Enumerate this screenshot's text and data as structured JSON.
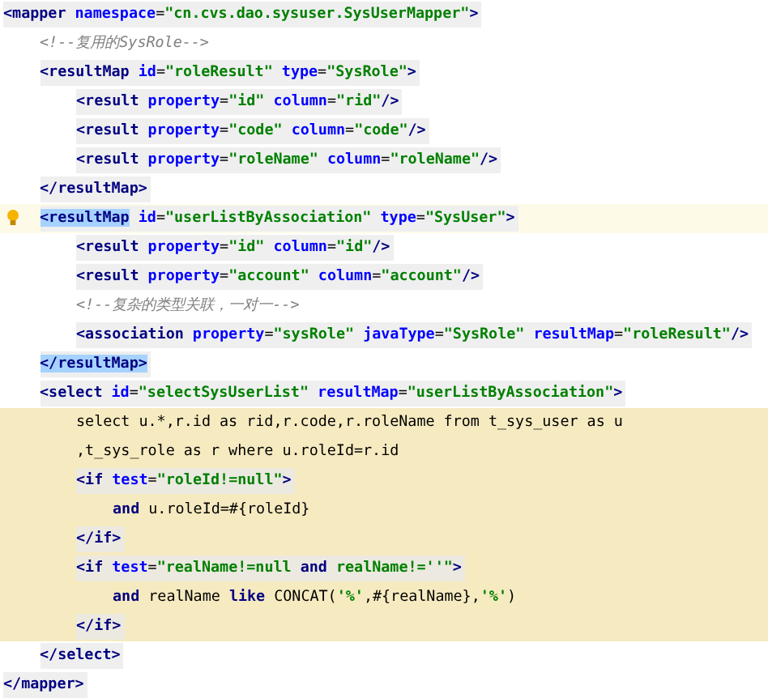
{
  "editor": {
    "lines": [
      {
        "kind": "tag",
        "tokens": [
          {
            "kind": "tag",
            "text": "<mapper"
          },
          {
            "kind": "attr",
            "text": " namespace"
          },
          {
            "kind": "punct",
            "text": "="
          },
          {
            "kind": "value",
            "text": "\"cn.cvs.dao.sysuser.SysUserMapper\""
          },
          {
            "kind": "tag",
            "text": ">"
          }
        ],
        "children": [
          {
            "kind": "comment",
            "tokens": [
              {
                "kind": "comment",
                "text": "<!--复用的SysRole-->"
              }
            ]
          },
          {
            "kind": "tag",
            "tokens": [
              {
                "kind": "tag",
                "text": "<resultMap"
              },
              {
                "kind": "attr",
                "text": " id"
              },
              {
                "kind": "punct",
                "text": "="
              },
              {
                "kind": "value",
                "text": "\"roleResult\""
              },
              {
                "kind": "attr",
                "text": " type"
              },
              {
                "kind": "punct",
                "text": "="
              },
              {
                "kind": "value",
                "text": "\"SysRole\""
              },
              {
                "kind": "tag",
                "text": ">"
              }
            ],
            "children": [
              {
                "kind": "tag",
                "tokens": [
                  {
                    "kind": "tag",
                    "text": "<result"
                  },
                  {
                    "kind": "attr",
                    "text": " property"
                  },
                  {
                    "kind": "punct",
                    "text": "="
                  },
                  {
                    "kind": "value",
                    "text": "\"id\""
                  },
                  {
                    "kind": "attr",
                    "text": " column"
                  },
                  {
                    "kind": "punct",
                    "text": "="
                  },
                  {
                    "kind": "value",
                    "text": "\"rid\""
                  },
                  {
                    "kind": "tag",
                    "text": "/>"
                  }
                ]
              },
              {
                "kind": "tag",
                "tokens": [
                  {
                    "kind": "tag",
                    "text": "<result"
                  },
                  {
                    "kind": "attr",
                    "text": " property"
                  },
                  {
                    "kind": "punct",
                    "text": "="
                  },
                  {
                    "kind": "value",
                    "text": "\"code\""
                  },
                  {
                    "kind": "attr",
                    "text": " column"
                  },
                  {
                    "kind": "punct",
                    "text": "="
                  },
                  {
                    "kind": "value",
                    "text": "\"code\""
                  },
                  {
                    "kind": "tag",
                    "text": "/>"
                  }
                ]
              },
              {
                "kind": "tag",
                "tokens": [
                  {
                    "kind": "tag",
                    "text": "<result"
                  },
                  {
                    "kind": "attr",
                    "text": " property"
                  },
                  {
                    "kind": "punct",
                    "text": "="
                  },
                  {
                    "kind": "value",
                    "text": "\"roleName\""
                  },
                  {
                    "kind": "attr",
                    "text": " column"
                  },
                  {
                    "kind": "punct",
                    "text": "="
                  },
                  {
                    "kind": "value",
                    "text": "\"roleName\""
                  },
                  {
                    "kind": "tag",
                    "text": "/>"
                  }
                ]
              }
            ]
          },
          {
            "kind": "tag",
            "tokens": [
              {
                "kind": "tag",
                "text": "</resultMap>"
              }
            ]
          },
          {
            "kind": "tag",
            "current_line": true,
            "bulb": true,
            "tokens": [
              {
                "kind": "tag",
                "text": "<resultMap",
                "selected": true
              },
              {
                "kind": "attr",
                "text": " id"
              },
              {
                "kind": "punct",
                "text": "="
              },
              {
                "kind": "value",
                "text": "\"userListByAssociation\""
              },
              {
                "kind": "attr",
                "text": " type"
              },
              {
                "kind": "punct",
                "text": "="
              },
              {
                "kind": "value",
                "text": "\"SysUser\""
              },
              {
                "kind": "tag",
                "text": ">"
              }
            ],
            "children": [
              {
                "kind": "tag",
                "tokens": [
                  {
                    "kind": "tag",
                    "text": "<result"
                  },
                  {
                    "kind": "attr",
                    "text": " property"
                  },
                  {
                    "kind": "punct",
                    "text": "="
                  },
                  {
                    "kind": "value",
                    "text": "\"id\""
                  },
                  {
                    "kind": "attr",
                    "text": " column"
                  },
                  {
                    "kind": "punct",
                    "text": "="
                  },
                  {
                    "kind": "value",
                    "text": "\"id\""
                  },
                  {
                    "kind": "tag",
                    "text": "/>"
                  }
                ]
              },
              {
                "kind": "tag",
                "tokens": [
                  {
                    "kind": "tag",
                    "text": "<result"
                  },
                  {
                    "kind": "attr",
                    "text": " property"
                  },
                  {
                    "kind": "punct",
                    "text": "="
                  },
                  {
                    "kind": "value",
                    "text": "\"account\""
                  },
                  {
                    "kind": "attr",
                    "text": " column"
                  },
                  {
                    "kind": "punct",
                    "text": "="
                  },
                  {
                    "kind": "value",
                    "text": "\"account\""
                  },
                  {
                    "kind": "tag",
                    "text": "/>"
                  }
                ]
              },
              {
                "kind": "comment",
                "tokens": [
                  {
                    "kind": "comment",
                    "text": "<!--复杂的类型关联，一对一-->"
                  }
                ]
              },
              {
                "kind": "tag",
                "tokens": [
                  {
                    "kind": "tag",
                    "text": "<association"
                  },
                  {
                    "kind": "attr",
                    "text": " property"
                  },
                  {
                    "kind": "punct",
                    "text": "="
                  },
                  {
                    "kind": "value",
                    "text": "\"sysRole\""
                  },
                  {
                    "kind": "attr",
                    "text": " javaType"
                  },
                  {
                    "kind": "punct",
                    "text": "="
                  },
                  {
                    "kind": "value",
                    "text": "\"SysRole\""
                  },
                  {
                    "kind": "attr",
                    "text": " resultMap"
                  },
                  {
                    "kind": "punct",
                    "text": "="
                  },
                  {
                    "kind": "value",
                    "text": "\"roleResult\""
                  },
                  {
                    "kind": "tag",
                    "text": "/>"
                  }
                ]
              }
            ]
          },
          {
            "kind": "tag",
            "tokens": [
              {
                "kind": "tag",
                "text": "</resultMap>",
                "selected": true
              }
            ]
          },
          {
            "kind": "tag",
            "tokens": [
              {
                "kind": "tag",
                "text": "<select"
              },
              {
                "kind": "attr",
                "text": " id"
              },
              {
                "kind": "punct",
                "text": "="
              },
              {
                "kind": "value",
                "text": "\"selectSysUserList\""
              },
              {
                "kind": "attr",
                "text": " resultMap"
              },
              {
                "kind": "punct",
                "text": "="
              },
              {
                "kind": "value",
                "text": "\"userListByAssociation\""
              },
              {
                "kind": "tag",
                "text": ">"
              }
            ],
            "children": [
              {
                "kind": "text",
                "injected": true,
                "tokens": [
                  {
                    "kind": "plain",
                    "text": "select u.*,r.id as rid,r.code,r.roleName from t_sys_user as u"
                  }
                ]
              },
              {
                "kind": "text",
                "injected": true,
                "tokens": [
                  {
                    "kind": "plain",
                    "text": ",t_sys_role as r where u.roleId=r.id"
                  }
                ]
              },
              {
                "kind": "tag",
                "injected": true,
                "tokens": [
                  {
                    "kind": "tag",
                    "text": "<if"
                  },
                  {
                    "kind": "attr",
                    "text": " test"
                  },
                  {
                    "kind": "punct",
                    "text": "="
                  },
                  {
                    "kind": "value",
                    "text": "\"roleId!=null\""
                  },
                  {
                    "kind": "tag",
                    "text": ">"
                  }
                ],
                "children": [
                  {
                    "kind": "text",
                    "injected": true,
                    "tokens": [
                      {
                        "kind": "keyword",
                        "text": "and"
                      },
                      {
                        "kind": "plain",
                        "text": " u.roleId=#{roleId}"
                      }
                    ]
                  }
                ]
              },
              {
                "kind": "tag",
                "injected": true,
                "tokens": [
                  {
                    "kind": "tag",
                    "text": "</if>"
                  }
                ]
              },
              {
                "kind": "tag",
                "injected": true,
                "tokens": [
                  {
                    "kind": "tag",
                    "text": "<if"
                  },
                  {
                    "kind": "attr",
                    "text": " test"
                  },
                  {
                    "kind": "punct",
                    "text": "="
                  },
                  {
                    "kind": "value",
                    "text": "\"realName!=null "
                  },
                  {
                    "kind": "keyword",
                    "text": "and"
                  },
                  {
                    "kind": "value",
                    "text": " realName!=''\""
                  },
                  {
                    "kind": "tag",
                    "text": ">"
                  }
                ],
                "children": [
                  {
                    "kind": "text",
                    "injected": true,
                    "tokens": [
                      {
                        "kind": "keyword",
                        "text": "and"
                      },
                      {
                        "kind": "plain",
                        "text": " realName "
                      },
                      {
                        "kind": "keyword",
                        "text": "like"
                      },
                      {
                        "kind": "plain",
                        "text": " CONCAT("
                      },
                      {
                        "kind": "value",
                        "text": "'%'"
                      },
                      {
                        "kind": "plain",
                        "text": ",#{realName},"
                      },
                      {
                        "kind": "value",
                        "text": "'%'"
                      },
                      {
                        "kind": "plain",
                        "text": ")"
                      }
                    ]
                  }
                ]
              },
              {
                "kind": "tag",
                "injected": true,
                "tokens": [
                  {
                    "kind": "tag",
                    "text": "</if>"
                  }
                ]
              }
            ]
          },
          {
            "kind": "tag",
            "tokens": [
              {
                "kind": "tag",
                "text": "</select>"
              }
            ]
          }
        ]
      },
      {
        "kind": "tag",
        "tokens": [
          {
            "kind": "tag",
            "text": "</mapper>"
          }
        ]
      }
    ]
  }
}
